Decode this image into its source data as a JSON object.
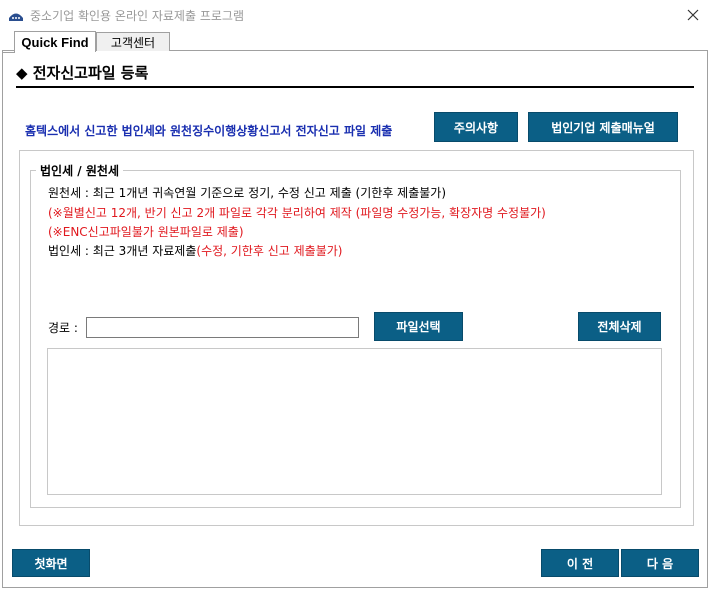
{
  "window": {
    "title": "중소기업 확인용 온라인 자료제출 프로그램",
    "close_icon": "close-icon"
  },
  "tabs": [
    {
      "label": "Quick Find",
      "active": true
    },
    {
      "label": "고객센터",
      "active": false
    }
  ],
  "page": {
    "title": "◆ 전자신고파일 등록",
    "description": "홈텍스에서 신고한 법인세와 원천징수이행상황신고서 전자신고 파일 제출"
  },
  "buttons": {
    "notice": "주의사항",
    "manual": "법인기업 제출매뉴얼",
    "select_file": "파일선택",
    "delete_all": "전체삭제",
    "home": "첫화면",
    "prev": "이 전",
    "next": "다 음"
  },
  "group": {
    "title": "법인세 / 원천세",
    "withholding_line": "원천세 : 최근 1개년 귀속연월 기준으로 정기, 수정 신고 제출 (기한후 제출불가)",
    "monthly_note": "(※월별신고 12개, 반기 신고 2개 파일로 각각 분리하여 제작 (파일명 수정가능, 확장자명 수정불가)",
    "enc_note": "(※ENC신고파일불가 원본파일로 제출)",
    "corp_tax_prefix": "법인세 : 최근 3개년 자료제출",
    "corp_tax_suffix": "(수정, 기한후 신고 제출불가)"
  },
  "path": {
    "label": "경로 :",
    "value": ""
  },
  "colors": {
    "button_bg": "#0b5f86",
    "description_text": "#1a2fb0",
    "warning_text": "#e0181e"
  }
}
